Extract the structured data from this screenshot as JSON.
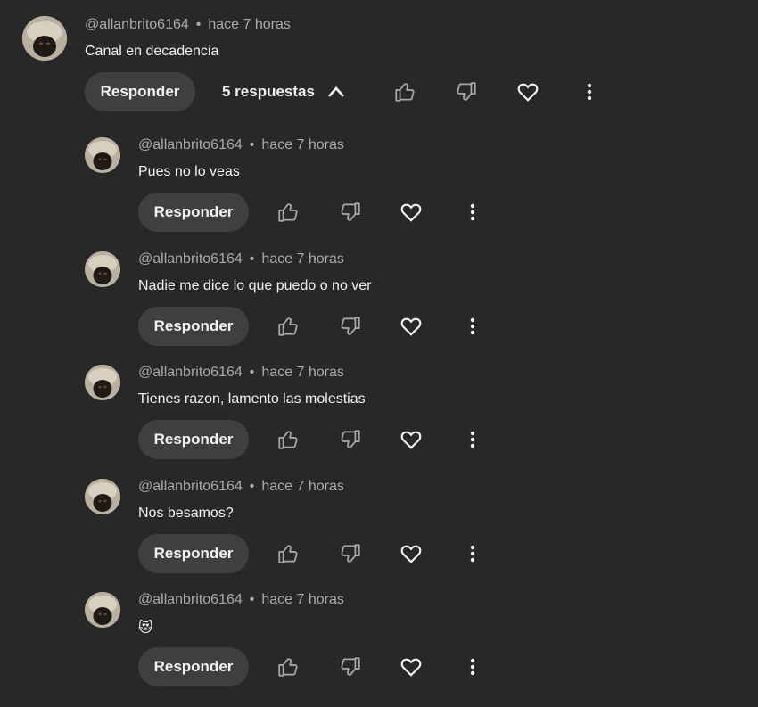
{
  "top_comment": {
    "author": "@allanbrito6164",
    "time": "hace 7 horas",
    "text": "Canal en decadencia",
    "reply_label": "Responder",
    "replies_count_label": "5 respuestas"
  },
  "separator": "•",
  "replies": [
    {
      "author": "@allanbrito6164",
      "time": "hace 7 horas",
      "text": "Pues no lo veas",
      "reply_label": "Responder"
    },
    {
      "author": "@allanbrito6164",
      "time": "hace 7 horas",
      "text": "Nadie me dice lo que puedo o no ver",
      "reply_label": "Responder"
    },
    {
      "author": "@allanbrito6164",
      "time": "hace 7 horas",
      "text": "Tienes razon, lamento las molestias",
      "reply_label": "Responder"
    },
    {
      "author": "@allanbrito6164",
      "time": "hace 7 horas",
      "text": "Nos besamos?",
      "reply_label": "Responder"
    },
    {
      "author": "@allanbrito6164",
      "time": "hace 7 horas",
      "text": "😻",
      "reply_label": "Responder"
    }
  ],
  "icons": {
    "like": "thumbs-up-icon",
    "dislike": "thumbs-down-icon",
    "heart": "heart-icon",
    "more": "more-vert-icon",
    "collapse": "chevron-up-icon"
  },
  "colors": {
    "background": "#282828",
    "button": "#3f3f3f",
    "text": "#f1f1f1",
    "meta": "#aaaaaa"
  }
}
